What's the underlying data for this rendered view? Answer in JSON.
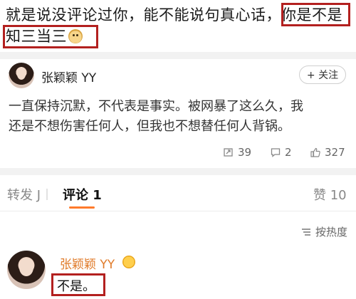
{
  "top_comment": {
    "line1_plain": "就是说没评论过你，能不能说句真心话，",
    "line1_highlight": "你是不是",
    "line2_highlight": "知三当三",
    "emoji": "doge-emoji"
  },
  "post": {
    "author": "张颖颖 YY",
    "follow_label": "+ 关注",
    "text_line1": "一直保持沉默，不代表是事实。被网暴了这么久，我",
    "text_line2": "还是不想伤害任何人，但我也不想替任何人背锅。",
    "reposts": "39",
    "comments": "2",
    "likes": "327"
  },
  "tabs": {
    "repost": "转发 J",
    "comment": "评论 1",
    "like": "赞 10"
  },
  "sort_label": "按热度",
  "reply": {
    "author": "张颖颖 YY",
    "text": "不是。"
  },
  "colors": {
    "highlight_border": "#b3201f",
    "accent_orange": "#ff7a2b",
    "vip_name": "#e07b2a"
  }
}
